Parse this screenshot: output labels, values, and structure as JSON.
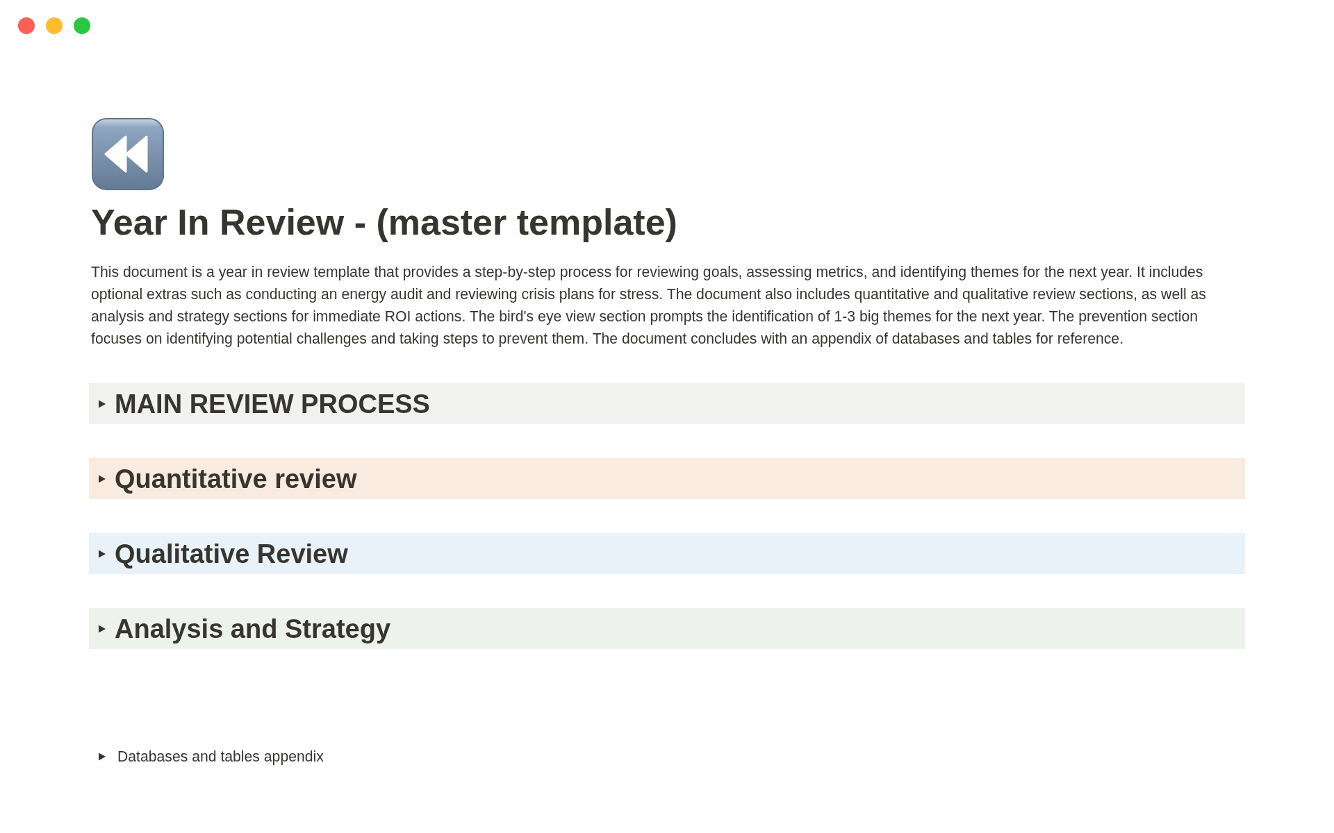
{
  "window": {
    "controls": [
      {
        "color": "#fe5f57"
      },
      {
        "color": "#febc2e"
      },
      {
        "color": "#28c840"
      }
    ]
  },
  "page": {
    "title": "Year In Review - (master template)",
    "description": "This document is a year in review template that provides a step-by-step process for reviewing goals, assessing metrics, and identifying themes for the next year. It includes optional extras such as conducting an energy audit and reviewing crisis plans for stress. The document also includes quantitative and qualitative review sections, as well as analysis and strategy sections for immediate ROI actions. The bird's eye view section prompts the identification of 1-3 big themes for the next year. The prevention section focuses on identifying potential challenges and taking steps to prevent them. The document concludes with an appendix of databases and tables for reference.",
    "toggles": [
      {
        "heading": "MAIN REVIEW PROCESS",
        "color": "#f1f1ef",
        "expanded": false
      },
      {
        "heading": "Quantitative review",
        "color": "#f9ebdf",
        "expanded": false
      },
      {
        "heading": "Qualitative Review",
        "color": "#e9f2f9",
        "expanded": false
      },
      {
        "heading": "Analysis and Strategy",
        "color": "#eef2ec",
        "expanded": false
      }
    ],
    "appendix": {
      "label": "Databases and tables appendix",
      "expanded": false
    }
  }
}
